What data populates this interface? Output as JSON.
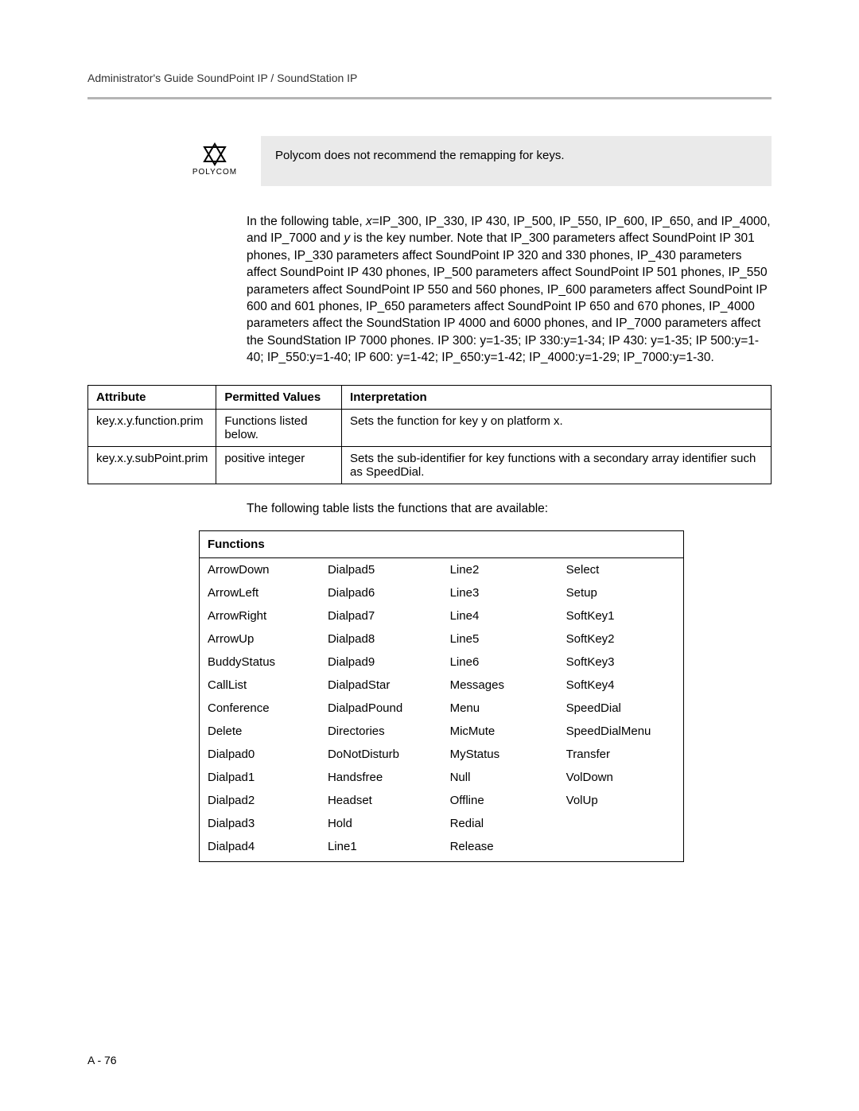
{
  "header": {
    "title": "Administrator's Guide SoundPoint IP / SoundStation IP"
  },
  "logo": {
    "caption": "POLYCOM"
  },
  "note": {
    "text": "Polycom does not recommend the remapping for keys."
  },
  "body": {
    "para1_pre": "In the following table, ",
    "para1_eq": "x",
    "para1_mid": "=IP_300, IP_330, IP 430, IP_500, IP_550, IP_600, IP_650, and IP_4000, and IP_7000 and ",
    "para1_y": "y",
    "para1_rest": " is the key number. Note that IP_300 parameters affect SoundPoint IP 301 phones, IP_330 parameters affect SoundPoint IP 320 and 330 phones, IP_430 parameters affect SoundPoint IP 430 phones, IP_500 parameters affect SoundPoint IP 501 phones, IP_550 parameters affect SoundPoint IP 550 and 560 phones, IP_600 parameters affect SoundPoint IP 600 and 601 phones, IP_650 parameters affect SoundPoint IP 650 and 670 phones, IP_4000 parameters affect the SoundStation IP 4000 and 6000 phones, and IP_7000 parameters affect the SoundStation IP 7000 phones. IP 300: ",
    "ranges": "y=1-35; IP 330:y=1-34; IP 430: y=1-35; IP 500:y=1-40; IP_550:y=1-40; IP 600: y=1-42; IP_650:y=1-42; IP_4000:y=1-29; IP_7000:y=1-30."
  },
  "attr_table": {
    "headers": [
      "Attribute",
      "Permitted Values",
      "Interpretation"
    ],
    "rows": [
      {
        "attr": "key.x.y.function.prim",
        "perm": "Functions listed below.",
        "interp": "Sets the function for key y on platform x."
      },
      {
        "attr": "key.x.y.subPoint.prim",
        "perm": "positive integer",
        "interp": "Sets the sub-identifier for key functions with a secondary array identifier such as SpeedDial."
      }
    ]
  },
  "mid_text": "The following table lists the functions that are available:",
  "func_table": {
    "header": "Functions",
    "rows": [
      [
        "ArrowDown",
        "Dialpad5",
        "Line2",
        "Select"
      ],
      [
        "ArrowLeft",
        "Dialpad6",
        "Line3",
        "Setup"
      ],
      [
        "ArrowRight",
        "Dialpad7",
        "Line4",
        "SoftKey1"
      ],
      [
        "ArrowUp",
        "Dialpad8",
        "Line5",
        "SoftKey2"
      ],
      [
        "BuddyStatus",
        "Dialpad9",
        "Line6",
        "SoftKey3"
      ],
      [
        "CallList",
        "DialpadStar",
        "Messages",
        "SoftKey4"
      ],
      [
        "Conference",
        "DialpadPound",
        "Menu",
        "SpeedDial"
      ],
      [
        "Delete",
        "Directories",
        "MicMute",
        "SpeedDialMenu"
      ],
      [
        "Dialpad0",
        "DoNotDisturb",
        "MyStatus",
        "Transfer"
      ],
      [
        "Dialpad1",
        "Handsfree",
        "Null",
        "VolDown"
      ],
      [
        "Dialpad2",
        "Headset",
        "Offline",
        "VolUp"
      ],
      [
        "Dialpad3",
        "Hold",
        "Redial",
        ""
      ],
      [
        "Dialpad4",
        "Line1",
        "Release",
        ""
      ]
    ]
  },
  "page_number": "A - 76"
}
